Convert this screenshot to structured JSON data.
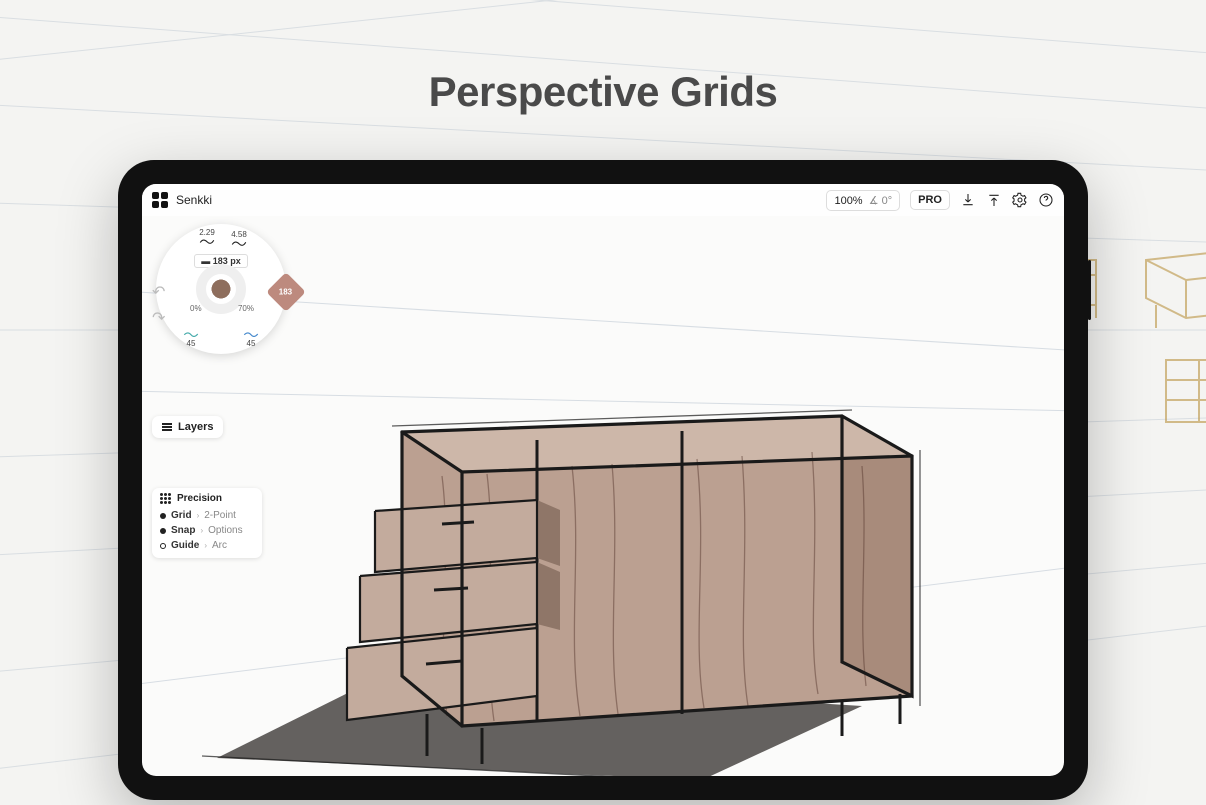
{
  "hero": {
    "title": "Perspective Grids"
  },
  "app": {
    "document_name": "Senkki",
    "zoom": "100%",
    "angle_label": "∡ 0°",
    "pro_badge": "PRO"
  },
  "radial": {
    "brush_size": "183 px",
    "top_left_value": "2.29",
    "top_right_value": "4.58",
    "opacity_left": "0%",
    "opacity_right": "70%",
    "bottom_left": "45",
    "bottom_right": "45",
    "callout_value": "183",
    "icons": {
      "undo": "undo-icon",
      "redo": "redo-icon"
    }
  },
  "layers_button": {
    "label": "Layers"
  },
  "precision": {
    "title": "Precision",
    "rows": [
      {
        "key": "Grid",
        "value": "2-Point"
      },
      {
        "key": "Snap",
        "value": "Options"
      },
      {
        "key": "Guide",
        "value": "Arc"
      }
    ]
  },
  "toolbar_icons": {
    "download": "download-icon",
    "upload": "upload-icon",
    "settings": "settings-icon",
    "help": "help-icon",
    "apps": "apps-grid-icon"
  },
  "colors": {
    "furniture_fill": "#bba091",
    "furniture_dark": "#52332a",
    "shadow": "#575451",
    "ink": "#1a1a1a",
    "sketch": "#c4a461",
    "grid": "#b9c3cc"
  }
}
